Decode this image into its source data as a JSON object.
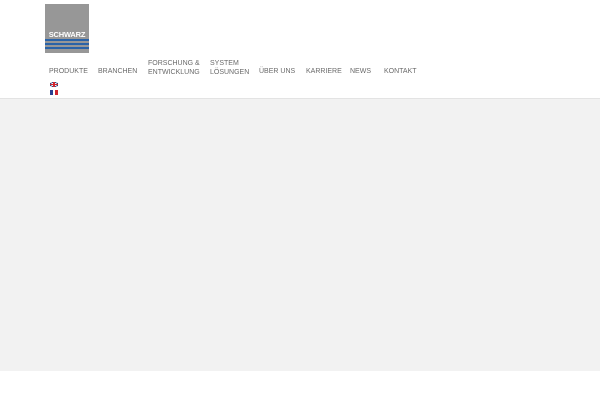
{
  "logo": {
    "text": "SCHWARZ",
    "background": "#979797",
    "stripe_color": "#2a63a8"
  },
  "nav": {
    "items": [
      {
        "label": "PRODUKTE"
      },
      {
        "label": "BRANCHEN"
      },
      {
        "line1": "FORSCHUNG &",
        "line2": "ENTWICKLUNG"
      },
      {
        "line1": "SYSTEM",
        "line2": "LÖSUNGEN"
      },
      {
        "label": "ÜBER UNS"
      },
      {
        "label": "KARRIERE"
      },
      {
        "label": "NEWS"
      },
      {
        "label": "KONTAKT"
      }
    ],
    "text_color": "#6a6a6a"
  },
  "languages": [
    {
      "icon": "uk-flag-icon"
    },
    {
      "icon": "france-flag-icon",
      "colors": [
        "#2a3f8f",
        "#ffffff",
        "#d0252d"
      ]
    }
  ],
  "content": {
    "background": "#f2f2f2"
  }
}
